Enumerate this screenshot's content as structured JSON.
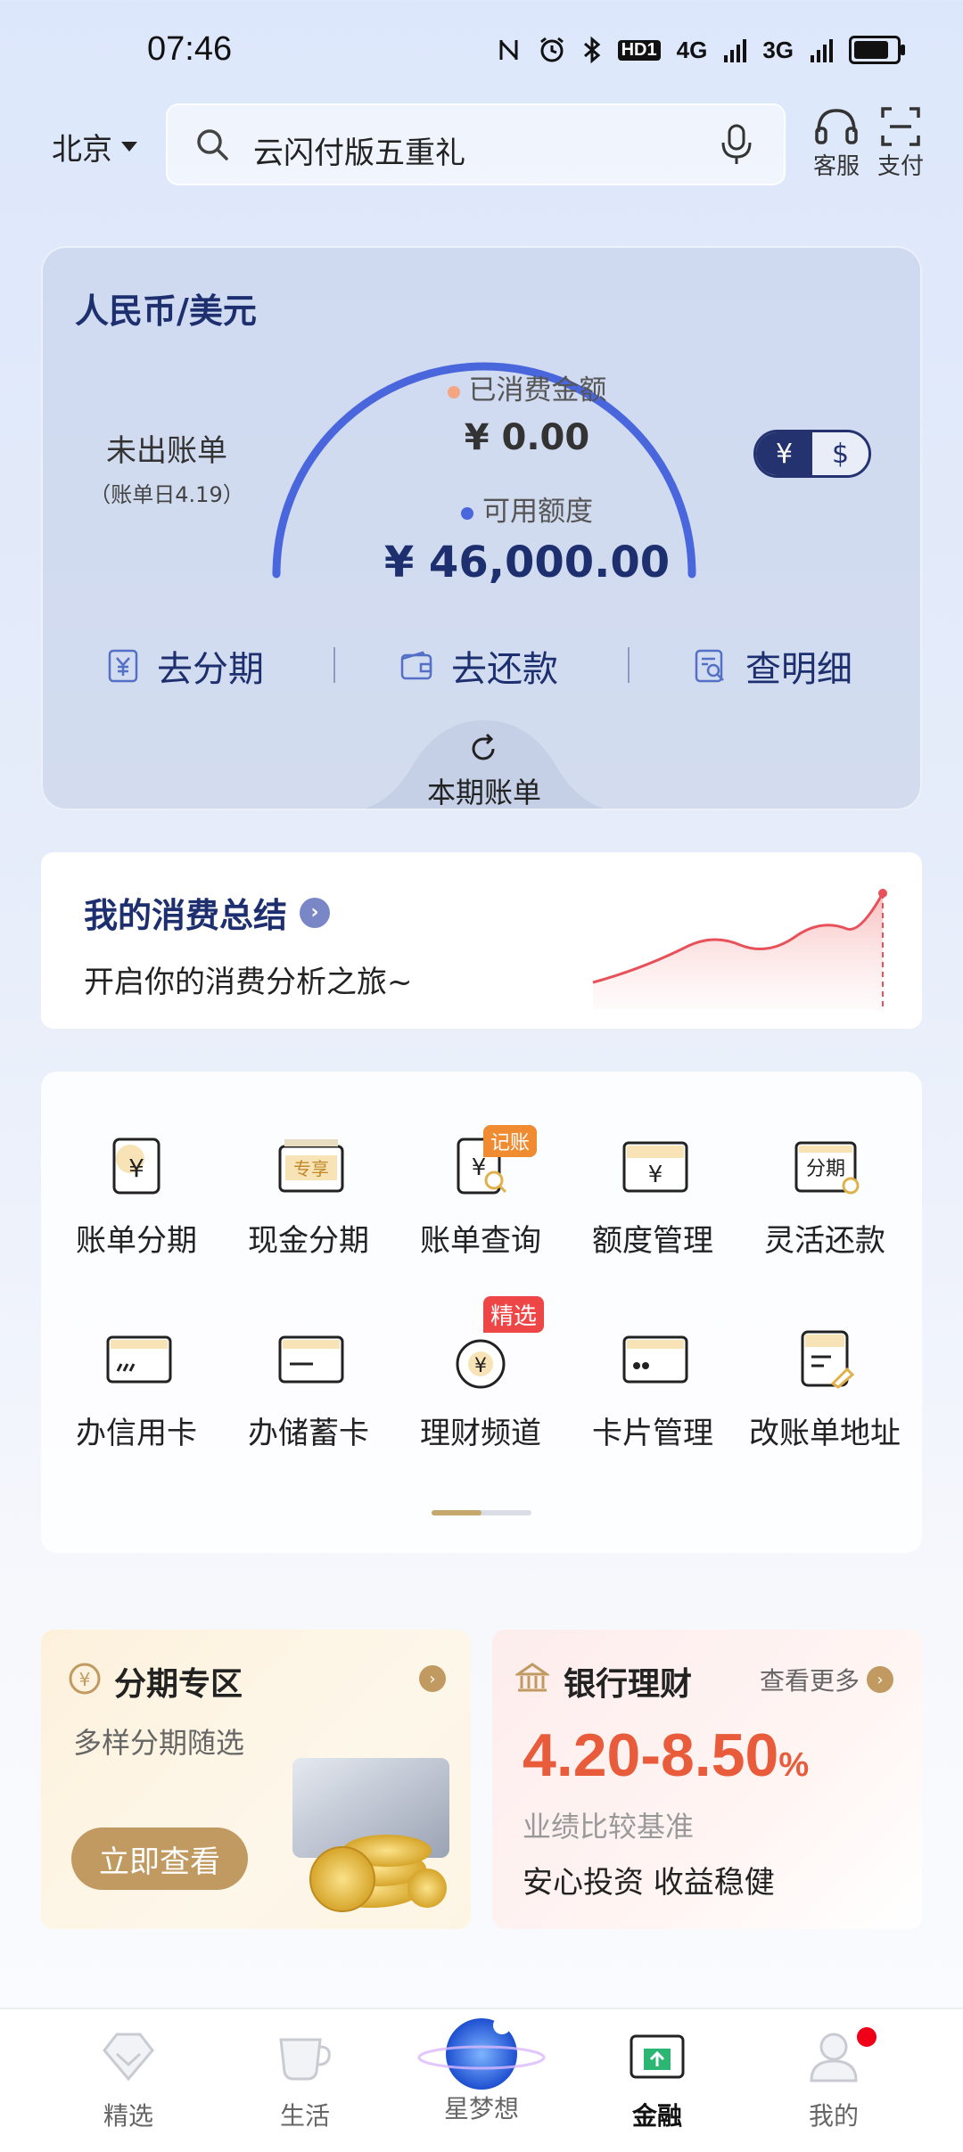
{
  "status": {
    "time": "07:46",
    "icons": [
      "nfc-icon",
      "alarm-icon",
      "bluetooth-icon",
      "hd-icon",
      "signal-4g-icon",
      "signal-3g-icon",
      "battery-icon"
    ],
    "hd": "HD1",
    "net1": "4G",
    "net2": "3G"
  },
  "header": {
    "city": "北京",
    "search_text": "云闪付版五重礼",
    "service_label": "客服",
    "pay_label": "支付"
  },
  "card": {
    "title": "人民币/美元",
    "unbilled_label": "未出账单",
    "bill_date": "（账单日4.19）",
    "spent_label": "已消费金额",
    "spent_value": "¥ 0.00",
    "available_label": "可用额度",
    "available_value": "¥ 46,000.00",
    "currency_cny": "¥",
    "currency_usd": "$",
    "actions": [
      "去分期",
      "去还款",
      "查明细"
    ],
    "bill_tab": "本期账单",
    "colors": {
      "gauge": "#4a66dd",
      "spent_dot": "#f4a582",
      "available_dot": "#4a66dd"
    }
  },
  "summary": {
    "title": "我的消费总结",
    "subtitle": "开启你的消费分析之旅~"
  },
  "grid": {
    "row1": [
      {
        "label": "账单分期",
        "icon": "bill-installment-icon"
      },
      {
        "label": "现金分期",
        "icon": "cash-installment-icon",
        "icon_text": "专享"
      },
      {
        "label": "账单查询",
        "icon": "bill-query-icon",
        "badge": "记账"
      },
      {
        "label": "额度管理",
        "icon": "limit-management-icon"
      },
      {
        "label": "灵活还款",
        "icon": "flexible-repayment-icon",
        "icon_text": "分期"
      }
    ],
    "row2": [
      {
        "label": "办信用卡",
        "icon": "credit-card-icon"
      },
      {
        "label": "办储蓄卡",
        "icon": "debit-card-icon"
      },
      {
        "label": "理财频道",
        "icon": "wealth-channel-icon",
        "badge": "精选"
      },
      {
        "label": "卡片管理",
        "icon": "card-management-icon"
      },
      {
        "label": "改账单地址",
        "icon": "bill-address-icon"
      }
    ]
  },
  "promo_installment": {
    "title": "分期专区",
    "subtitle": "多样分期随选",
    "cta": "立即查看"
  },
  "promo_wealth": {
    "title": "银行理财",
    "more": "查看更多",
    "rate": "4.20-8.50",
    "rate_unit": "%",
    "benchmark": "业绩比较基准",
    "slogan": "安心投资 收益稳健"
  },
  "nav": [
    {
      "label": "精选",
      "icon": "diamond-icon"
    },
    {
      "label": "生活",
      "icon": "cup-icon"
    },
    {
      "label": "星梦想",
      "icon": "planet-icon"
    },
    {
      "label": "金融",
      "icon": "finance-icon",
      "active": true
    },
    {
      "label": "我的",
      "icon": "user-icon"
    }
  ]
}
